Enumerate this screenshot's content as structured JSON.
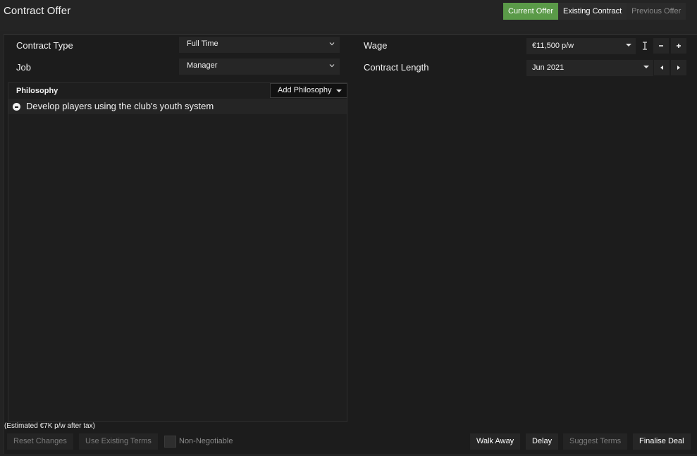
{
  "header": {
    "title": "Contract Offer",
    "tabs": [
      {
        "label": "Current Offer",
        "active": true
      },
      {
        "label": "Existing Contract",
        "active": false
      },
      {
        "label": "Previous Offer",
        "active": false
      }
    ]
  },
  "terms": {
    "contract_type_label": "Contract Type",
    "contract_type_value": "Full Time",
    "job_label": "Job",
    "job_value": "Manager",
    "wage_label": "Wage",
    "wage_value": "€11,500 p/w",
    "contract_length_label": "Contract Length",
    "contract_length_value": "Jun 2021"
  },
  "philosophy": {
    "heading": "Philosophy",
    "add_button": "Add Philosophy",
    "items": [
      "Develop players using the club's youth system"
    ]
  },
  "footer": {
    "estimate": "(Estimated €7K p/w after tax)",
    "reset_changes": "Reset Changes",
    "use_existing_terms": "Use Existing Terms",
    "non_negotiable": "Non-Negotiable",
    "walk_away": "Walk Away",
    "delay": "Delay",
    "suggest_terms": "Suggest Terms",
    "finalise_deal": "Finalise Deal"
  },
  "icons": {
    "wage_cursor": "text-cursor-icon",
    "decrement": "minus-icon",
    "increment": "plus-icon",
    "prev": "arrow-left-icon",
    "next": "arrow-right-icon",
    "remove": "remove-circle-icon"
  },
  "colors": {
    "accent": "#5a9a48",
    "background": "#1c1c1c"
  }
}
